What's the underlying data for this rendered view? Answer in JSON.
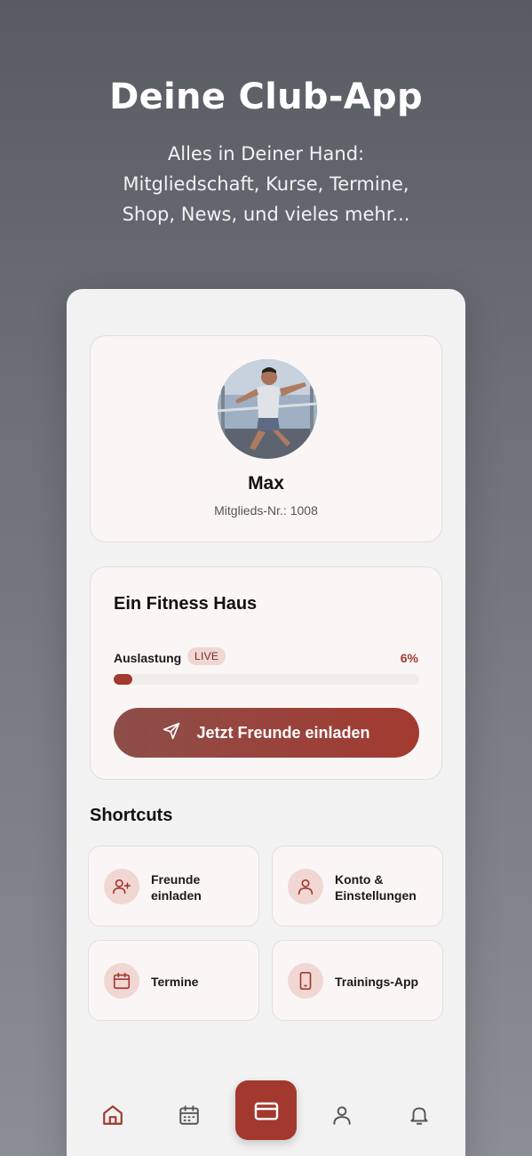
{
  "promo": {
    "title": "Deine Club-App",
    "subtitle_line1": "Alles in Deiner Hand:",
    "subtitle_line2": "Mitgliedschaft, Kurse, Termine,",
    "subtitle_line3": "Shop, News, und vieles mehr..."
  },
  "profile": {
    "name": "Max",
    "member_number": "Mitglieds-Nr.: 1008"
  },
  "club": {
    "name": "Ein Fitness Haus",
    "occupancy_label": "Auslastung",
    "live_badge": "LIVE",
    "occupancy_value": "6%",
    "occupancy_fraction": 0.06,
    "invite_button": "Jetzt Freunde einladen"
  },
  "shortcuts": {
    "title": "Shortcuts",
    "items": [
      {
        "line1": "Freunde",
        "line2": "einladen",
        "icon": "user-plus-icon"
      },
      {
        "line1": "Konto &",
        "line2": "Einstellungen",
        "icon": "user-icon"
      },
      {
        "line1": "Termine",
        "line2": "",
        "icon": "calendar-icon"
      },
      {
        "line1": "Trainings-App",
        "line2": "",
        "icon": "smartphone-icon"
      }
    ]
  },
  "nav": {
    "items": [
      "home-icon",
      "calendar-icon",
      "membership-card-icon",
      "profile-icon",
      "bell-icon"
    ]
  },
  "colors": {
    "accent": "#a3392e",
    "accent_soft": "#f0d7d4",
    "card_bg": "#faf6f5",
    "screen_bg": "#f2f2f2"
  }
}
